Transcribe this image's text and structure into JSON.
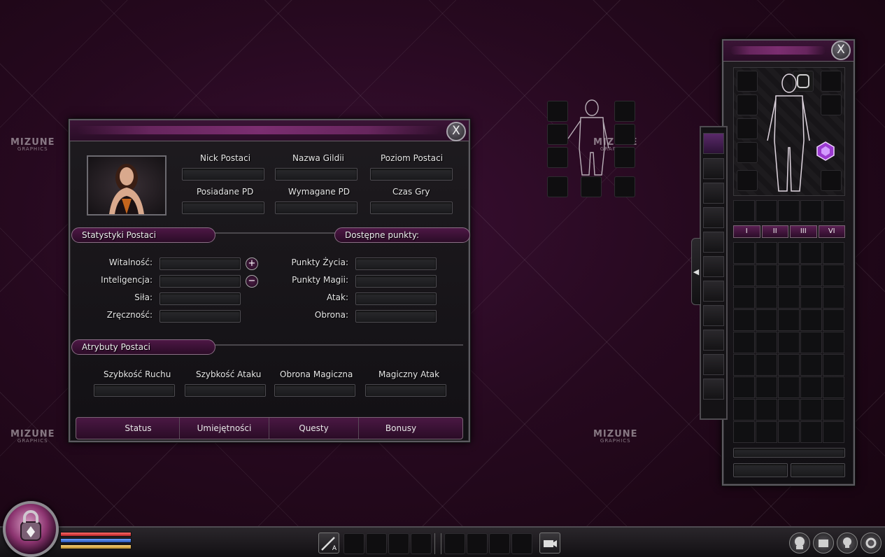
{
  "watermark": {
    "brand": "MIZUNE",
    "sub": "GRAPHICS"
  },
  "character_window": {
    "close_label": "X",
    "info_fields": [
      {
        "label": "Nick Postaci"
      },
      {
        "label": "Nazwa Gildii"
      },
      {
        "label": "Poziom Postaci"
      },
      {
        "label": "Posiadane PD"
      },
      {
        "label": "Wymagane PD"
      },
      {
        "label": "Czas Gry"
      }
    ],
    "stats_section": "Statystyki Postaci",
    "points_section": "Dostępne punkty:",
    "stats": [
      "Witalność:",
      "Inteligencja:",
      "Siła:",
      "Zręczność:"
    ],
    "stat_buttons": {
      "plus": "+",
      "minus": "−"
    },
    "derived": [
      "Punkty Życia:",
      "Punkty Magii:",
      "Atak:",
      "Obrona:"
    ],
    "attributes_section": "Atrybuty Postaci",
    "attributes": [
      "Szybkość Ruchu",
      "Szybkość Ataku",
      "Obrona Magiczna",
      "Magiczny Atak"
    ],
    "tabs": [
      "Status",
      "Umiejętności",
      "Questy",
      "Bonusy"
    ]
  },
  "inventory_window": {
    "close_label": "X",
    "page_tabs": [
      "I",
      "II",
      "III",
      "VI"
    ]
  },
  "hotbar": {
    "skill_key_label": "A"
  },
  "colors": {
    "accent": "#7e2f72",
    "hp": "#d43a3a",
    "mp": "#3a6fd4",
    "exp": "#d4a33a"
  }
}
